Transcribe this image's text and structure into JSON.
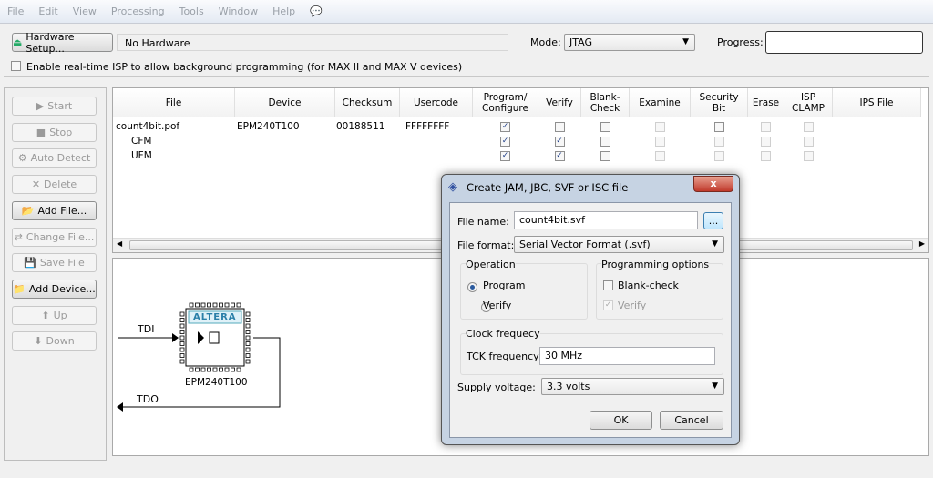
{
  "menu": [
    "File",
    "Edit",
    "View",
    "Processing",
    "Tools",
    "Window",
    "Help"
  ],
  "toolbar": {
    "hardware_setup": "Hardware Setup...",
    "hardware_value": "No Hardware",
    "mode_label": "Mode:",
    "mode_value": "JTAG",
    "progress_label": "Progress:",
    "progress_value": 0,
    "realtime_isp": "Enable real-time ISP to allow background programming (for MAX II and MAX V devices)"
  },
  "side_buttons": [
    {
      "label": "Start",
      "enabled": false,
      "icon": "start-icon"
    },
    {
      "label": "Stop",
      "enabled": false,
      "icon": "stop-icon"
    },
    {
      "label": "Auto Detect",
      "enabled": false,
      "icon": "auto-detect-icon"
    },
    {
      "label": "Delete",
      "enabled": false,
      "icon": "delete-icon"
    },
    {
      "label": "Add File...",
      "enabled": true,
      "icon": "folder-icon"
    },
    {
      "label": "Change File...",
      "enabled": false,
      "icon": "change-file-icon"
    },
    {
      "label": "Save File",
      "enabled": false,
      "icon": "save-icon"
    },
    {
      "label": "Add Device...",
      "enabled": true,
      "icon": "add-device-icon"
    },
    {
      "label": "Up",
      "enabled": false,
      "icon": "up-arrow-icon"
    },
    {
      "label": "Down",
      "enabled": false,
      "icon": "down-arrow-icon"
    }
  ],
  "table": {
    "columns": [
      "File",
      "Device",
      "Checksum",
      "Usercode",
      "Program/\nConfigure",
      "Verify",
      "Blank-\nCheck",
      "Examine",
      "Security\nBit",
      "Erase",
      "ISP\nCLAMP",
      "IPS File"
    ],
    "rows": [
      {
        "file": "count4bit.pof",
        "device": "EPM240T100",
        "checksum": "00188511",
        "usercode": "FFFFFFFF",
        "checks": [
          "on",
          "off",
          "off",
          "dis",
          "off",
          "dis",
          "dis"
        ]
      },
      {
        "file": "CFM",
        "device": "",
        "checksum": "",
        "usercode": "",
        "checks": [
          "on",
          "on",
          "off",
          "dis",
          "dis",
          "dis",
          "dis"
        ]
      },
      {
        "file": "UFM",
        "device": "",
        "checksum": "",
        "usercode": "",
        "checks": [
          "on",
          "on",
          "off",
          "dis",
          "dis",
          "dis",
          "dis"
        ]
      }
    ]
  },
  "chain": {
    "tdi": "TDI",
    "tdo": "TDO",
    "device": "EPM240T100",
    "logo": "ALTERA"
  },
  "dialog": {
    "title": "Create JAM, JBC, SVF or ISC file",
    "file_name_label": "File name:",
    "file_name": "count4bit.svf",
    "browse": "...",
    "file_format_label": "File format:",
    "file_format": "Serial Vector Format (.svf)",
    "operation": "Operation",
    "program": "Program",
    "verify": "Verify",
    "prog_options": "Programming options",
    "blank_check": "Blank-check",
    "opt_verify": "Verify",
    "clock": "Clock frequecy",
    "tck_label": "TCK frequency:",
    "tck_value": "30 MHz",
    "supply_label": "Supply voltage:",
    "supply_value": "3.3 volts",
    "ok": "OK",
    "cancel": "Cancel",
    "close": "x"
  }
}
